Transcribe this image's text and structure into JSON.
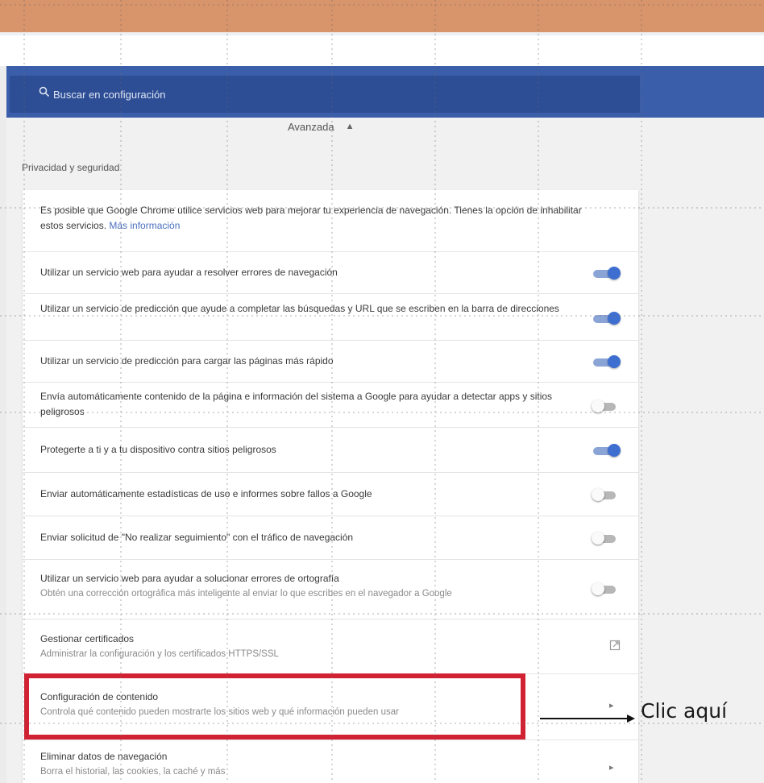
{
  "search": {
    "placeholder": "Buscar en configuración"
  },
  "advanced": {
    "label": "Avanzada"
  },
  "section": {
    "title": "Privacidad y seguridad"
  },
  "intro": {
    "text": "Es posible que Google Chrome utilice servicios web para mejorar tu experiencia de navegación. Tienes la opción de inhabilitar estos servicios.",
    "link": "Más información"
  },
  "settings": [
    {
      "label": "Utilizar un servicio web para ayudar a resolver errores de navegación",
      "enabled": true
    },
    {
      "label": "Utilizar un servicio de predicción que ayude a completar las búsquedas y URL que se escriben en la barra de direcciones",
      "enabled": true
    },
    {
      "label": "Utilizar un servicio de predicción para cargar las páginas más rápido",
      "enabled": true
    },
    {
      "label": "Envía automáticamente contenido de la página e información del sistema a Google para ayudar a detectar apps y sitios peligrosos",
      "enabled": false
    },
    {
      "label": "Protegerte a ti y a tu dispositivo contra sitios peligrosos",
      "enabled": true
    },
    {
      "label": "Enviar automáticamente estadísticas de uso e informes sobre fallos a Google",
      "enabled": false
    },
    {
      "label": "Enviar solicitud de \"No realizar seguimiento\" con el tráfico de navegación",
      "enabled": false
    },
    {
      "label": "Utilizar un servicio web para ayudar a solucionar errores de ortografía",
      "sublabel": "Obtén una corrección ortográfica más inteligente al enviar lo que escribes en el navegador a Google",
      "enabled": false
    }
  ],
  "links": [
    {
      "label": "Gestionar certificados",
      "sublabel": "Administrar la configuración y los certificados HTTPS/SSL"
    },
    {
      "label": "Configuración de contenido",
      "sublabel": "Controla qué contenido pueden mostrarte los sitios web y qué información pueden usar"
    },
    {
      "label": "Eliminar datos de navegación",
      "sublabel": "Borra el historial, las cookies, la caché y más"
    }
  ],
  "annotation": {
    "text": "Clic aquí"
  },
  "colors": {
    "header_band": "#d8946b",
    "search_bar": "#3a5ea9",
    "toggle_on": "#3e6fd0",
    "highlight_border": "#d02233"
  }
}
